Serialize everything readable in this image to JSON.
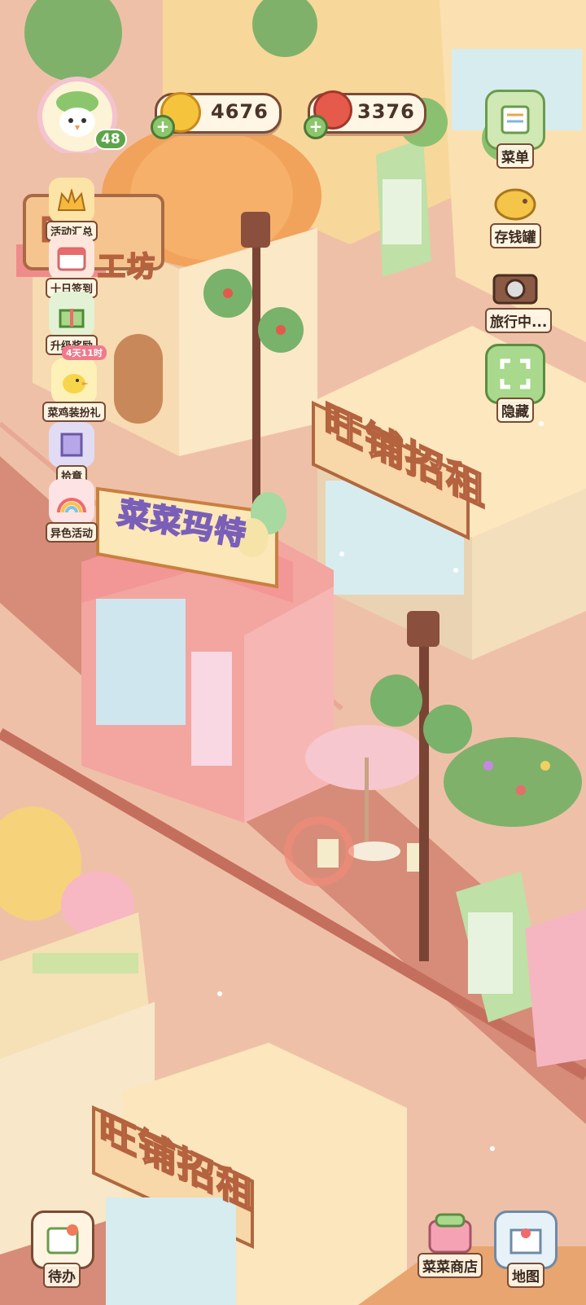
{
  "hud": {
    "coins": "4676",
    "radishes": "3376",
    "level": "48"
  },
  "left_menu": [
    {
      "label": "活动汇总",
      "icon": "crown-icon"
    },
    {
      "label": "十日签到",
      "icon": "calendar-icon"
    },
    {
      "label": "升级奖励",
      "icon": "gift-icon"
    },
    {
      "label": "菜鸡装扮礼",
      "icon": "duck-icon",
      "badge": "4天11时"
    },
    {
      "label": "拾章",
      "icon": "stamp-icon"
    },
    {
      "label": "异色活动",
      "icon": "rainbow-icon"
    }
  ],
  "right_menu": [
    {
      "label": "菜单",
      "icon": "menu-icon"
    },
    {
      "label": "存钱罐",
      "icon": "piggy-bank-icon"
    },
    {
      "label": "旅行中...",
      "icon": "camera-icon"
    },
    {
      "label": "隐藏",
      "icon": "hide-icon"
    }
  ],
  "bottom": {
    "todo": "待办",
    "shop": "菜菜商店",
    "map": "地图"
  },
  "signs": {
    "rent_top": "旺铺招租",
    "rent_bottom": "旺铺招租",
    "machine": "菜菜玛特",
    "workshop_a": "匠",
    "workshop_b": "工坊"
  },
  "colors": {
    "ground": "#e9b59c",
    "sidewalk": "#f3c9b3",
    "road": "#d98e78",
    "accent_green": "#8cc66c"
  }
}
